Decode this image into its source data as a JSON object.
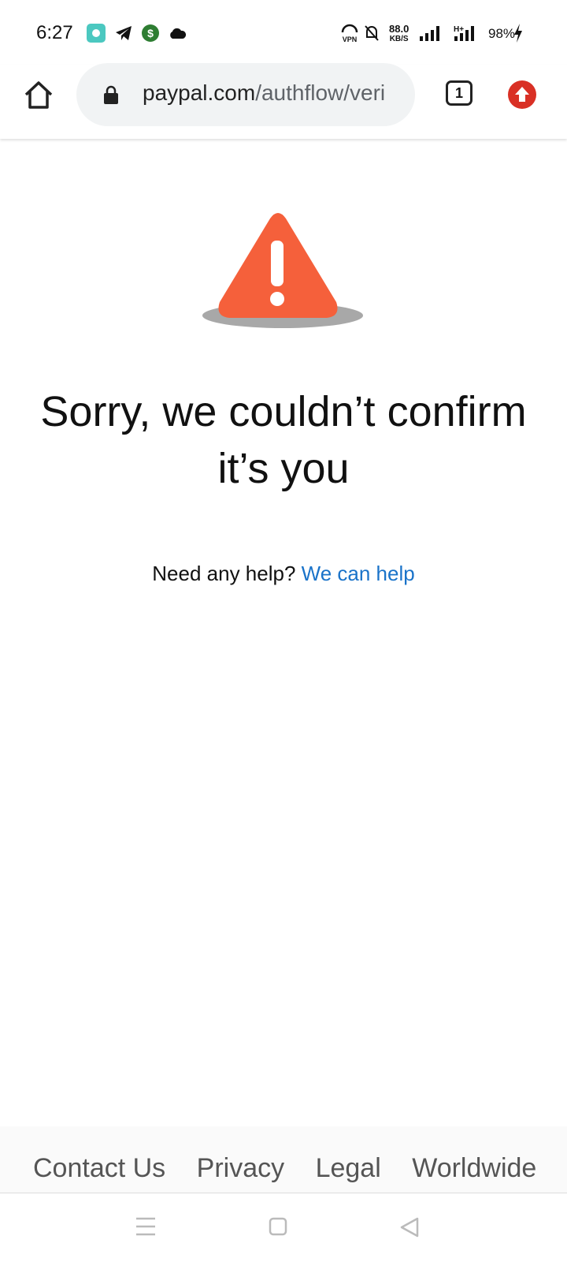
{
  "status_bar": {
    "time": "6:27",
    "speed_value": "88.0",
    "speed_unit": "KB/S",
    "battery": "98%",
    "icons_left": [
      "app-icon",
      "telegram-icon",
      "dollar-icon",
      "cloud-icon"
    ],
    "icons_right": [
      "vpn-icon",
      "bell-off-icon",
      "signal-icon",
      "signal-h-icon",
      "battery-charging-icon"
    ]
  },
  "browser": {
    "url_domain": "paypal.com",
    "url_path": "/authflow/veri",
    "tab_count": "1"
  },
  "content": {
    "title": "Sorry, we couldn’t confirm it’s you",
    "help_prefix": "Need any help?",
    "help_link": "We can help"
  },
  "footer": {
    "links": [
      "Contact Us",
      "Privacy",
      "Legal",
      "Worldwide"
    ]
  },
  "colors": {
    "warning": "#f5603b",
    "link": "#1a73c9",
    "update_badge": "#d93025"
  }
}
